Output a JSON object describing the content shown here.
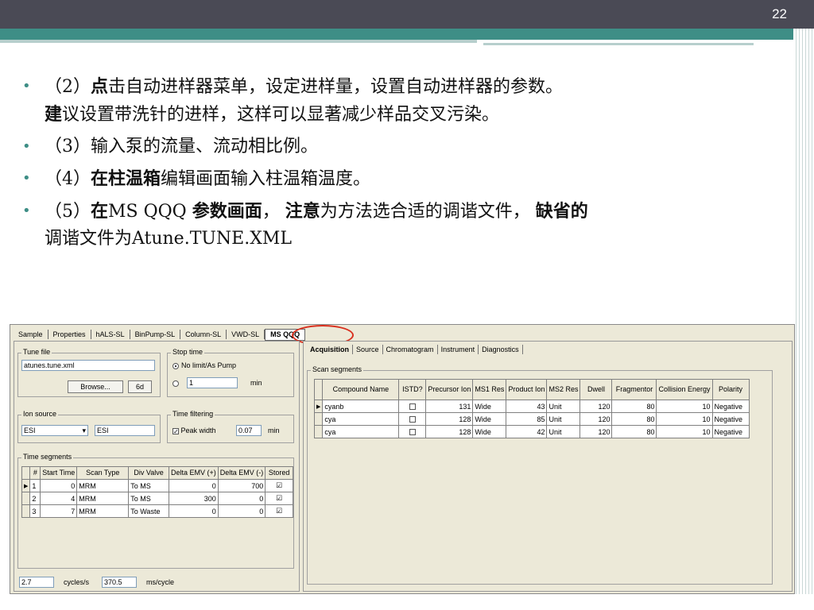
{
  "slide": {
    "number": "22"
  },
  "bullets": [
    {
      "bold_pre": "",
      "parts": [
        "（2）",
        "点",
        "击自动进样器菜单，设定进样量，设置自动进样器的参数。",
        "建",
        "议设置带洗针的进样，这样可以显著减少样品交叉污染。"
      ]
    },
    {
      "text": "（3）输入泵的流量、流动相比例。"
    },
    {
      "parts": [
        "（4）",
        "在柱温箱",
        "编辑画面输入柱温箱温度。"
      ]
    },
    {
      "parts": [
        "（5）",
        "在",
        "MS QQQ ",
        "参数画面",
        "，",
        "注意",
        "为方法选合适的调谐文件，",
        "缺省的",
        "调谐文件为Atune.TUNE.XML"
      ]
    }
  ],
  "screenshot": {
    "main_tabs": [
      "Sample",
      "Properties",
      "hALS-SL",
      "BinPump-SL",
      "Column-SL",
      "VWD-SL",
      "MS QQQ"
    ],
    "tune_file": {
      "legend": "Tune file",
      "value": "atunes.tune.xml",
      "browse": "Browse...",
      "edit": "6d"
    },
    "stop_time": {
      "legend": "Stop time",
      "opt1": "No limit/As Pump",
      "value": "1",
      "unit": "min"
    },
    "ion_source": {
      "legend": "Ion source",
      "value": "ESI",
      "value2": "ESI"
    },
    "time_filtering": {
      "legend": "Time filtering",
      "label": "Peak width",
      "value": "0.07",
      "unit": "min"
    },
    "time_segments": {
      "legend": "Time segments",
      "headers": [
        "#",
        "Start Time",
        "Scan Type",
        "Div Valve",
        "Delta EMV (+)",
        "Delta EMV (-)",
        "Stored"
      ],
      "rows": [
        [
          "1",
          "0",
          "MRM",
          "To MS",
          "0",
          "700",
          "☑"
        ],
        [
          "2",
          "4",
          "MRM",
          "To MS",
          "300",
          "0",
          "☑"
        ],
        [
          "3",
          "7",
          "MRM",
          "To Waste",
          "0",
          "0",
          "☑"
        ]
      ]
    },
    "cycles": {
      "value": "2.7",
      "label": "cycles/s",
      "ms_value": "370.5",
      "ms_label": "ms/cycle"
    },
    "sub_tabs": [
      "Acquisition",
      "Source",
      "Chromatogram",
      "Instrument",
      "Diagnostics"
    ],
    "scan_segments": {
      "legend": "Scan segments",
      "headers": [
        "Compound Name",
        "ISTD?",
        "Precursor Ion",
        "MS1 Res",
        "Product Ion",
        "MS2 Res",
        "Dwell",
        "Fragmentor",
        "Collision Energy",
        "Polarity"
      ],
      "rows": [
        [
          "cyanb",
          "",
          "131",
          "Wide",
          "43",
          "Unit",
          "120",
          "80",
          "10",
          "Negative"
        ],
        [
          "cya",
          "",
          "128",
          "Wide",
          "85",
          "Unit",
          "120",
          "80",
          "10",
          "Negative"
        ],
        [
          "cya",
          "",
          "128",
          "Wide",
          "42",
          "Unit",
          "120",
          "80",
          "10",
          "Negative"
        ]
      ]
    }
  },
  "colors": {
    "accent": "#3e8e86",
    "header": "#4a4a55",
    "highlight": "#d9301e"
  }
}
